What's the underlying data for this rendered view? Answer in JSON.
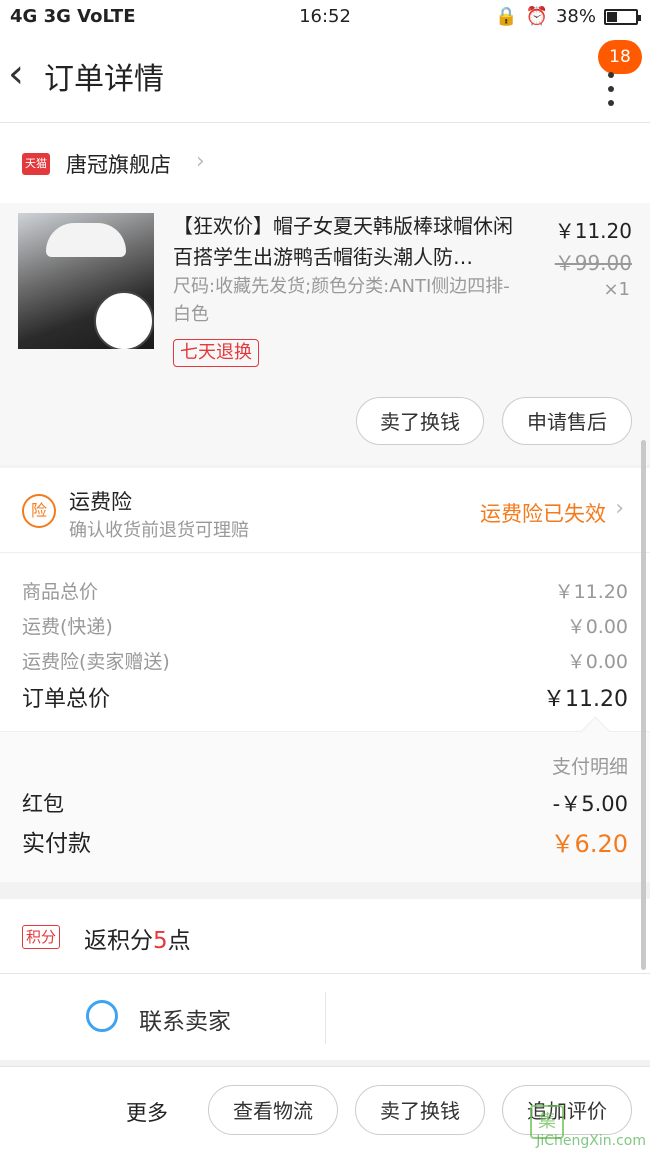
{
  "status_bar": {
    "network": "4G 3G VoLTE",
    "time": "16:52",
    "battery": "38%"
  },
  "navbar": {
    "back_icon": "chevron-left-icon",
    "title": "订单详情",
    "badge_count": "18",
    "more_icon": "more-vertical-icon"
  },
  "shop": {
    "logo_text": "天猫",
    "name": "唐冠旗舰店",
    "arrow": "›"
  },
  "product": {
    "title": "【狂欢价】帽子女夏天韩版棒球帽休闲百搭学生出游鸭舌帽街头潮人防…",
    "attributes": "尺码:收藏先发货;颜色分类:ANTI侧边四排-白色",
    "tag": "七天退换",
    "price": "￥11.20",
    "original_price": "￥99.00",
    "quantity": "×1",
    "buttons": [
      "卖了换钱",
      "申请售后"
    ]
  },
  "insurance": {
    "icon_text": "险",
    "title": "运费险",
    "subtitle": "确认收货前退货可理赔",
    "status": "运费险已失效",
    "arrow": "›"
  },
  "summary": {
    "rows": [
      {
        "label": "商品总价",
        "value": "￥11.20"
      },
      {
        "label": "运费(快递)",
        "value": "￥0.00"
      },
      {
        "label": "运费险(卖家赠送)",
        "value": "￥0.00"
      }
    ],
    "total_label": "订单总价",
    "total_value": "￥11.20"
  },
  "payment": {
    "detail_label": "支付明细",
    "redpacket_label": "红包",
    "redpacket_value": "-￥5.00",
    "paid_label": "实付款",
    "paid_value": "￥6.20"
  },
  "points": {
    "tag": "积分",
    "prefix": "返积分",
    "amount": "5",
    "suffix": "点"
  },
  "contact": {
    "label": "联系卖家"
  },
  "bottom_bar": {
    "more": "更多",
    "buttons": [
      "查看物流",
      "卖了换钱",
      "追加评价"
    ]
  },
  "watermark": {
    "logo": "集",
    "text": "JiChengXin.com"
  },
  "colors": {
    "accent": "#f37b1d",
    "tmall_red": "#e4393c",
    "badge": "#ff5a00",
    "contact_blue": "#3ea3f0"
  }
}
